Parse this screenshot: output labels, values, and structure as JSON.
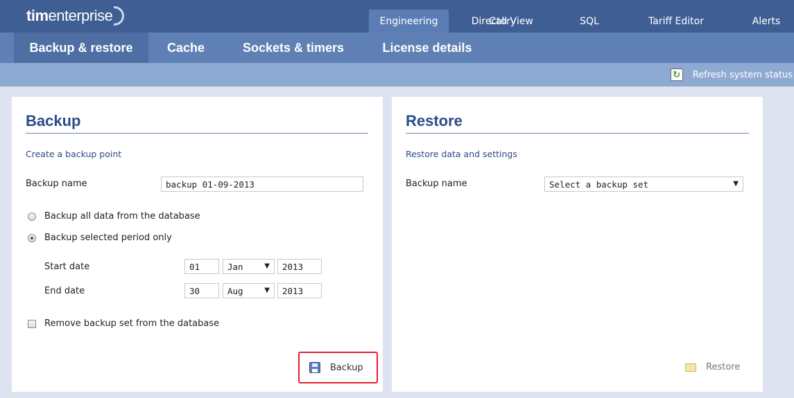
{
  "app": {
    "brand_bold": "tim",
    "brand_rest": "enterprise"
  },
  "nav": {
    "main_tabs": [
      {
        "label": "Engineering",
        "active": true
      },
      {
        "label": "Directory",
        "active": false
      },
      {
        "label": "Call View",
        "active": false
      },
      {
        "label": "SQL",
        "active": false
      },
      {
        "label": "Tariff Editor",
        "active": false
      },
      {
        "label": "Alerts",
        "active": false
      }
    ],
    "sub_tabs": [
      {
        "label": "Backup & restore",
        "active": true
      },
      {
        "label": "Cache",
        "active": false
      },
      {
        "label": "Sockets & timers",
        "active": false
      },
      {
        "label": "License details",
        "active": false
      }
    ]
  },
  "toolbar": {
    "refresh_label": "Refresh system status"
  },
  "backup": {
    "title": "Backup",
    "subtitle": "Create a backup point",
    "name_label": "Backup name",
    "name_value": "backup 01-09-2013",
    "option_all": "Backup all data from the database",
    "option_period": "Backup selected period only",
    "selected_option": "period",
    "start_label": "Start date",
    "start_day": "01",
    "start_month": "Jan",
    "start_year": "2013",
    "end_label": "End date",
    "end_day": "30",
    "end_month": "Aug",
    "end_year": "2013",
    "remove_label": "Remove backup set from the database",
    "remove_checked": false,
    "button_label": "Backup"
  },
  "restore": {
    "title": "Restore",
    "subtitle": "Restore data and settings",
    "name_label": "Backup name",
    "select_value": "Select a backup set",
    "button_label": "Restore"
  },
  "colors": {
    "accent": "#3f5f94",
    "sub_nav": "#5f80b4",
    "toolbar": "#8faad2",
    "heading": "#2a4c87",
    "highlight": "#e0202a"
  }
}
